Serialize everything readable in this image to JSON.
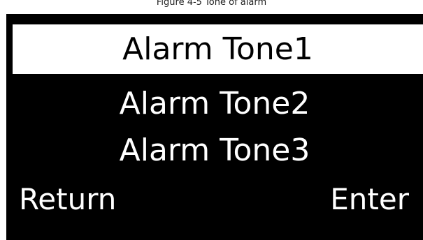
{
  "caption": "Figure 4-5 Tone of alarm",
  "menu": {
    "items": [
      {
        "label": "Alarm Tone1",
        "selected": true
      },
      {
        "label": "Alarm Tone2",
        "selected": false
      },
      {
        "label": "Alarm Tone3",
        "selected": false
      }
    ]
  },
  "softkeys": {
    "left_label": "Return",
    "right_label": "Enter"
  },
  "colors": {
    "screen_background": "#000000",
    "text": "#ffffff",
    "selection_background": "#ffffff",
    "selection_text": "#000000"
  }
}
